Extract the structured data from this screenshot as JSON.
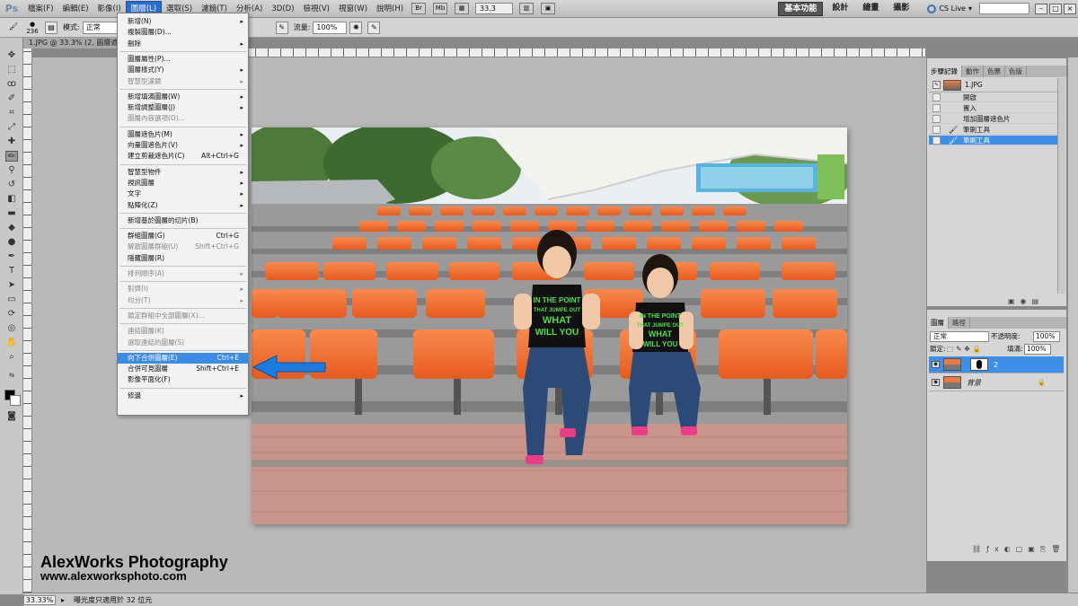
{
  "app": {
    "logo": "Ps"
  },
  "menubar": {
    "items": [
      "檔案(F)",
      "編輯(E)",
      "影像(I)",
      "圖層(L)",
      "選取(S)",
      "濾鏡(T)",
      "分析(A)",
      "3D(D)",
      "檢視(V)",
      "視窗(W)",
      "說明(H)"
    ],
    "active_index": 3,
    "icons": [
      "Br",
      "Mb"
    ],
    "zoom": "33.3",
    "workspaces": [
      "基本功能",
      "設計",
      "繪畫",
      "攝影"
    ],
    "active_workspace": 0,
    "cs_live": "CS Live"
  },
  "options": {
    "brush_size": "236",
    "mode_label": "模式:",
    "mode_value": "正常",
    "flow_label": "流量:",
    "flow_value": "100%"
  },
  "document": {
    "tab_title": "1.JPG @ 33.3% (2, 圖層遮色片"
  },
  "layer_menu": {
    "items": [
      {
        "label": "新增(N)",
        "submenu": true
      },
      {
        "label": "複製圖層(D)..."
      },
      {
        "label": "刪除",
        "submenu": true
      },
      {
        "sep": true
      },
      {
        "label": "圖層屬性(P)..."
      },
      {
        "label": "圖層樣式(Y)",
        "submenu": true
      },
      {
        "label": "智慧型濾鏡",
        "submenu": true,
        "disabled": true
      },
      {
        "sep": true
      },
      {
        "label": "新增填滿圖層(W)",
        "submenu": true
      },
      {
        "label": "新增調整圖層(J)",
        "submenu": true
      },
      {
        "label": "圖層內容選項(O)...",
        "disabled": true
      },
      {
        "sep": true
      },
      {
        "label": "圖層遮色片(M)",
        "submenu": true
      },
      {
        "label": "向量圖遮色片(V)",
        "submenu": true
      },
      {
        "label": "建立剪裁遮色片(C)",
        "shortcut": "Alt+Ctrl+G"
      },
      {
        "sep": true
      },
      {
        "label": "智慧型物件",
        "submenu": true
      },
      {
        "label": "視訊圖層",
        "submenu": true
      },
      {
        "label": "文字",
        "submenu": true
      },
      {
        "label": "點陣化(Z)",
        "submenu": true
      },
      {
        "sep": true
      },
      {
        "label": "新增基於圖層的切片(B)"
      },
      {
        "sep": true
      },
      {
        "label": "群組圖層(G)",
        "shortcut": "Ctrl+G"
      },
      {
        "label": "解散圖層群組(U)",
        "shortcut": "Shift+Ctrl+G",
        "disabled": true
      },
      {
        "label": "隱藏圖層(R)"
      },
      {
        "sep": true
      },
      {
        "label": "排列順序(A)",
        "submenu": true,
        "disabled": true
      },
      {
        "sep": true
      },
      {
        "label": "對齊(I)",
        "submenu": true,
        "disabled": true
      },
      {
        "label": "均分(T)",
        "submenu": true,
        "disabled": true
      },
      {
        "sep": true
      },
      {
        "label": "鎖定群組中全部圖層(X)...",
        "disabled": true
      },
      {
        "sep": true
      },
      {
        "label": "連結圖層(K)",
        "disabled": true
      },
      {
        "label": "選取連結的圖層(S)",
        "disabled": true
      },
      {
        "sep": true
      },
      {
        "label": "向下合併圖層(E)",
        "shortcut": "Ctrl+E",
        "selected": true
      },
      {
        "label": "合併可見圖層",
        "shortcut": "Shift+Ctrl+E"
      },
      {
        "label": "影像平面化(F)"
      },
      {
        "sep": true
      },
      {
        "label": "修邊",
        "submenu": true
      }
    ]
  },
  "history_panel": {
    "tabs": [
      "步驟記錄",
      "動作",
      "色票",
      "色版"
    ],
    "snapshot": "1.JPG",
    "items": [
      "開啟",
      "置入",
      "增加圖層遮色片",
      "筆刷工具",
      "筆刷工具"
    ],
    "selected_index": 4
  },
  "layers_panel": {
    "tabs": [
      "圖層",
      "路徑"
    ],
    "blend_mode": "正常",
    "opacity_label": "不透明度:",
    "opacity": "100%",
    "lock_label": "鎖定:",
    "fill_label": "填滿:",
    "fill": "100%",
    "layers": [
      {
        "name": "2",
        "selected": true
      },
      {
        "name": "背景",
        "locked": true
      }
    ]
  },
  "photo": {
    "shirt_lines": [
      "IN THE POINT",
      "THAT JUMPE OUT",
      "WHAT",
      "WILL YOU"
    ]
  },
  "status": {
    "zoom": "33.33%",
    "message": "曝光度只適用於 32 位元"
  },
  "watermark": {
    "line1": "AlexWorks Photography",
    "line2": "www.alexworksphoto.com"
  },
  "colors": {
    "menu_highlight": "#3b8be8",
    "arrow": "#1a7be0",
    "seat_orange": "#f06a2a"
  }
}
